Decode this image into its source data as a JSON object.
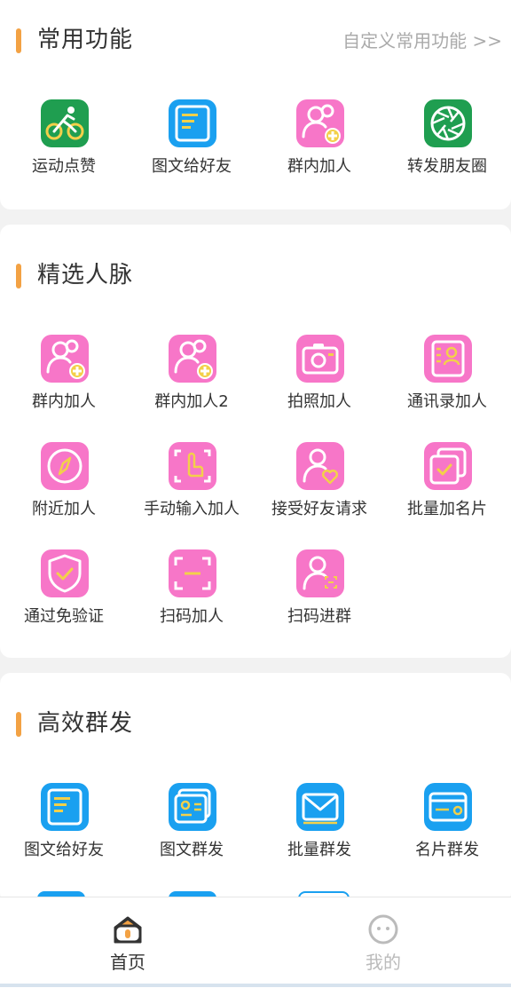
{
  "colors": {
    "accent": "#f3a244",
    "pink": "#f776c8",
    "blue": "#1aa0f0",
    "green": "#1f9e50",
    "badge_yellow": "#f3d04a",
    "tab_active": "#333333",
    "tab_inactive": "#bbbbbb"
  },
  "common": {
    "title": "常用功能",
    "customize": "自定义常用功能 >>",
    "items": [
      {
        "label": "运动点赞",
        "icon": "cycling-icon"
      },
      {
        "label": "图文给好友",
        "icon": "document-icon"
      },
      {
        "label": "群内加人",
        "icon": "add-group-member-icon"
      },
      {
        "label": "转发朋友圈",
        "icon": "moments-shutter-icon"
      }
    ]
  },
  "contacts": {
    "title": "精选人脉",
    "items": [
      {
        "label": "群内加人",
        "icon": "add-group-member-icon"
      },
      {
        "label": "群内加人2",
        "icon": "add-group-member-icon"
      },
      {
        "label": "拍照加人",
        "icon": "camera-icon"
      },
      {
        "label": "通讯录加人",
        "icon": "contact-book-icon"
      },
      {
        "label": "附近加人",
        "icon": "compass-icon"
      },
      {
        "label": "手动输入加人",
        "icon": "tap-hand-icon"
      },
      {
        "label": "接受好友请求",
        "icon": "person-heart-icon"
      },
      {
        "label": "批量加名片",
        "icon": "stacked-check-icon"
      },
      {
        "label": "通过免验证",
        "icon": "shield-check-icon"
      },
      {
        "label": "扫码加人",
        "icon": "scan-icon"
      },
      {
        "label": "扫码进群",
        "icon": "person-scan-icon"
      }
    ]
  },
  "broadcast": {
    "title": "高效群发",
    "items": [
      {
        "label": "图文给好友",
        "icon": "document-icon"
      },
      {
        "label": "图文群发",
        "icon": "image-text-icon"
      },
      {
        "label": "批量群发",
        "icon": "mail-icon"
      },
      {
        "label": "名片群发",
        "icon": "card-icon"
      }
    ]
  },
  "tabbar": {
    "home": "首页",
    "mine": "我的"
  }
}
